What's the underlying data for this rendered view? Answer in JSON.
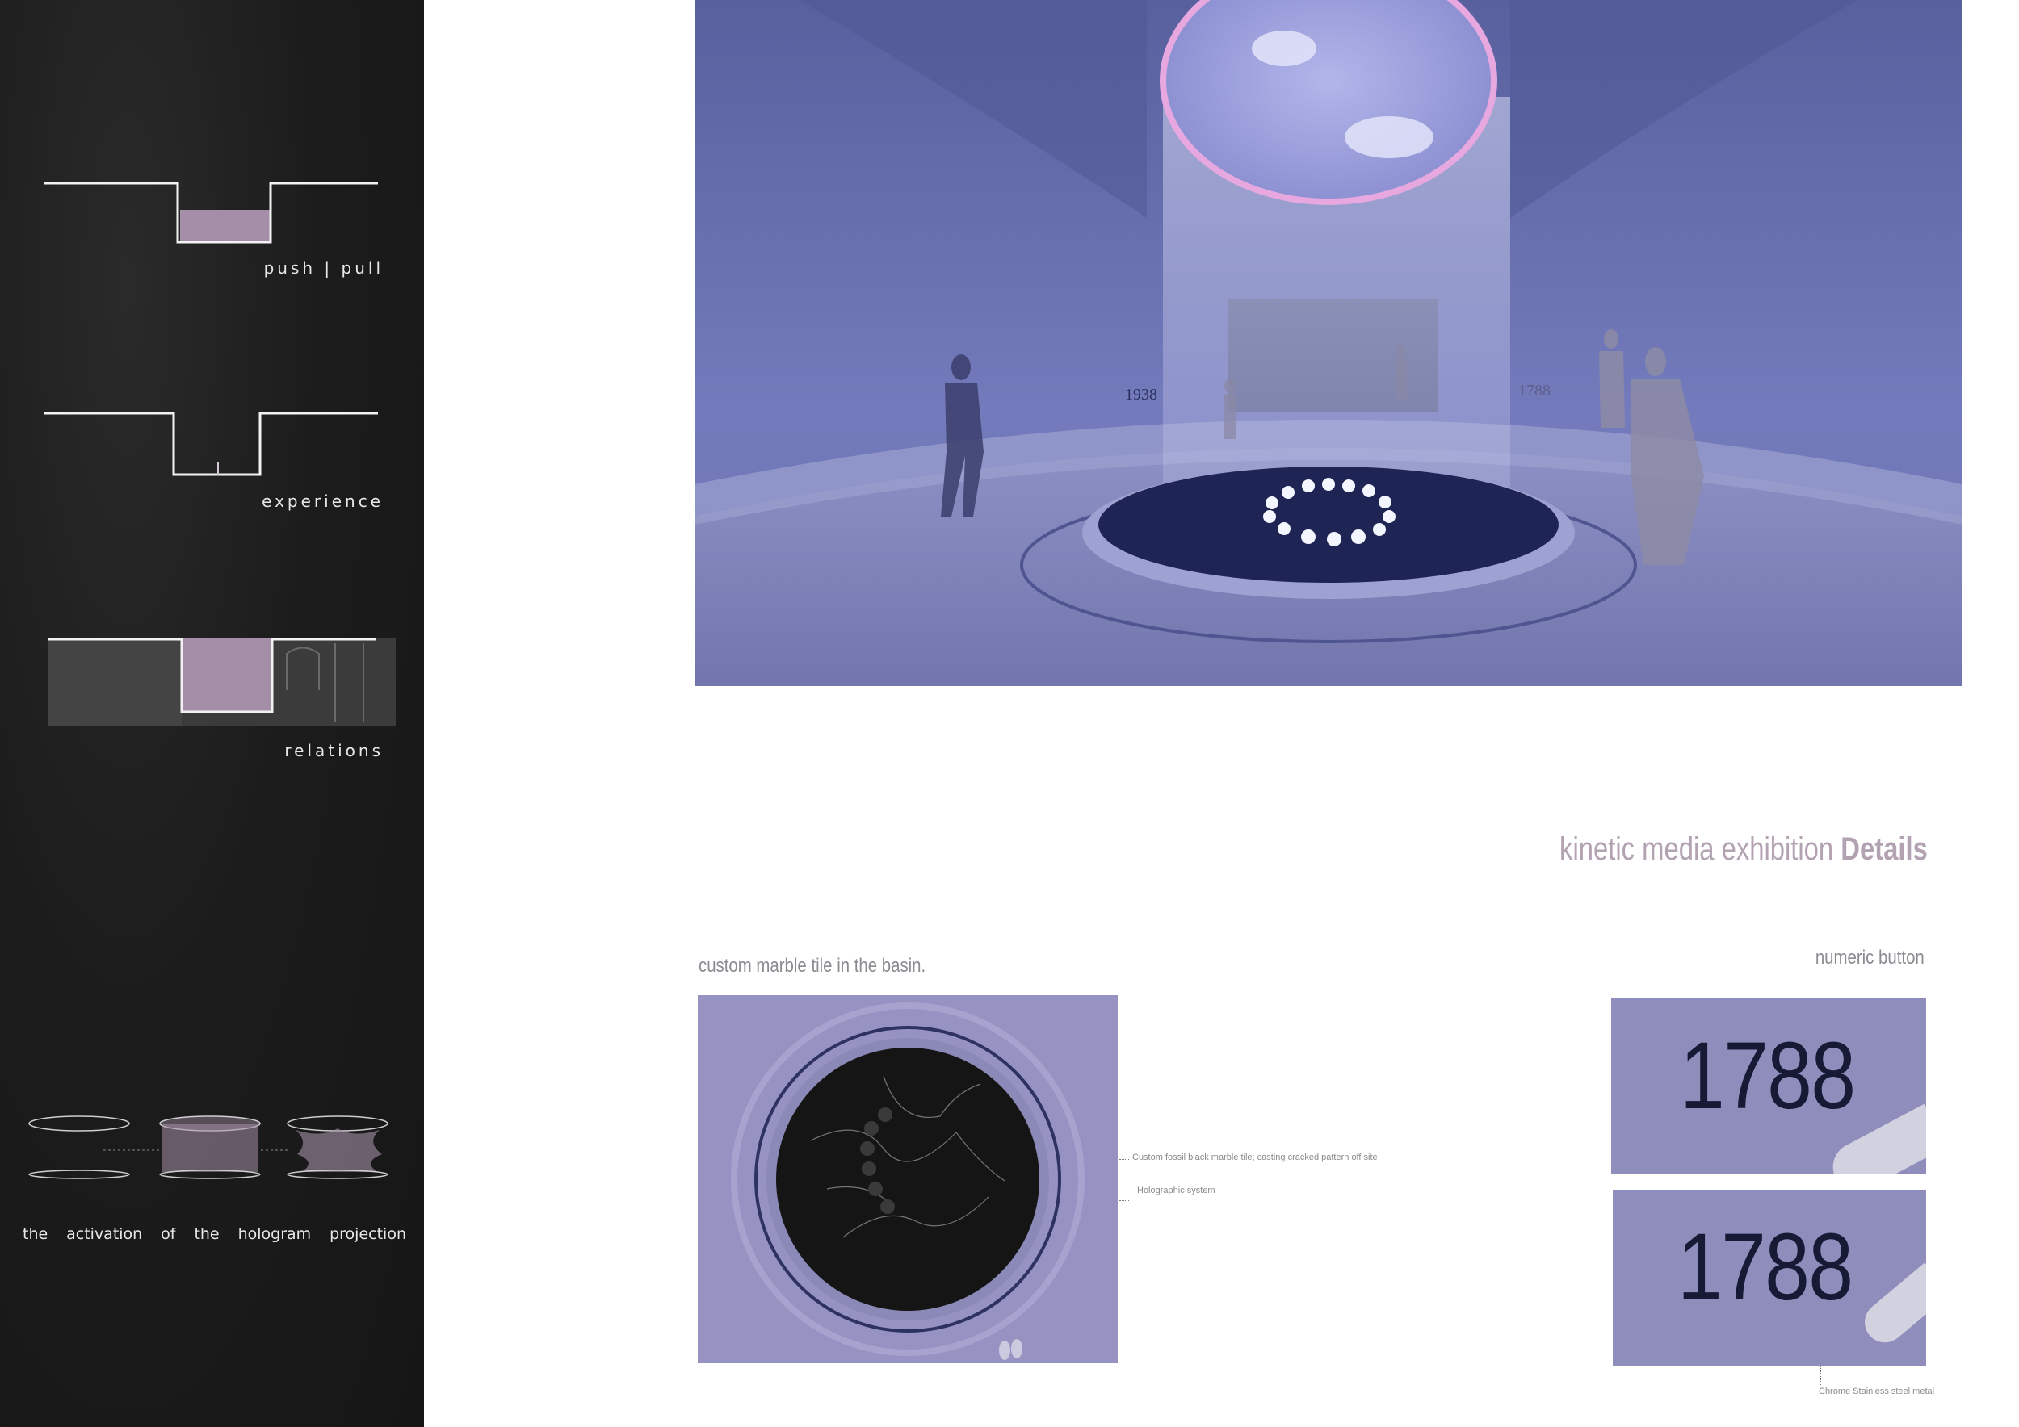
{
  "sidebar": {
    "diagram_labels": {
      "push_pull": "push | pull",
      "experience": "experience",
      "relations": "relations"
    },
    "caption_words": [
      "the",
      "activation",
      "of",
      "the",
      "hologram",
      "projection"
    ]
  },
  "render": {
    "year_left": "1938",
    "year_right": "1788"
  },
  "details": {
    "title_light": "kinetic media exhibition ",
    "title_bold": "Details",
    "marble_heading": "custom marble tile in the basin.",
    "button_heading": "numeric button",
    "note_marble": "Custom fossil black marble tile; casting cracked pattern off site",
    "note_holo": "Holographic system",
    "note_steel": "Chrome Stainless steel metal",
    "button_number_1": "1788",
    "button_number_2": "1788"
  },
  "colors": {
    "panel_bg": "#1c1c1c",
    "accent_purple": "#a58fa8",
    "render_blue": "#6a6fae",
    "title_color": "#b3a3b2"
  }
}
